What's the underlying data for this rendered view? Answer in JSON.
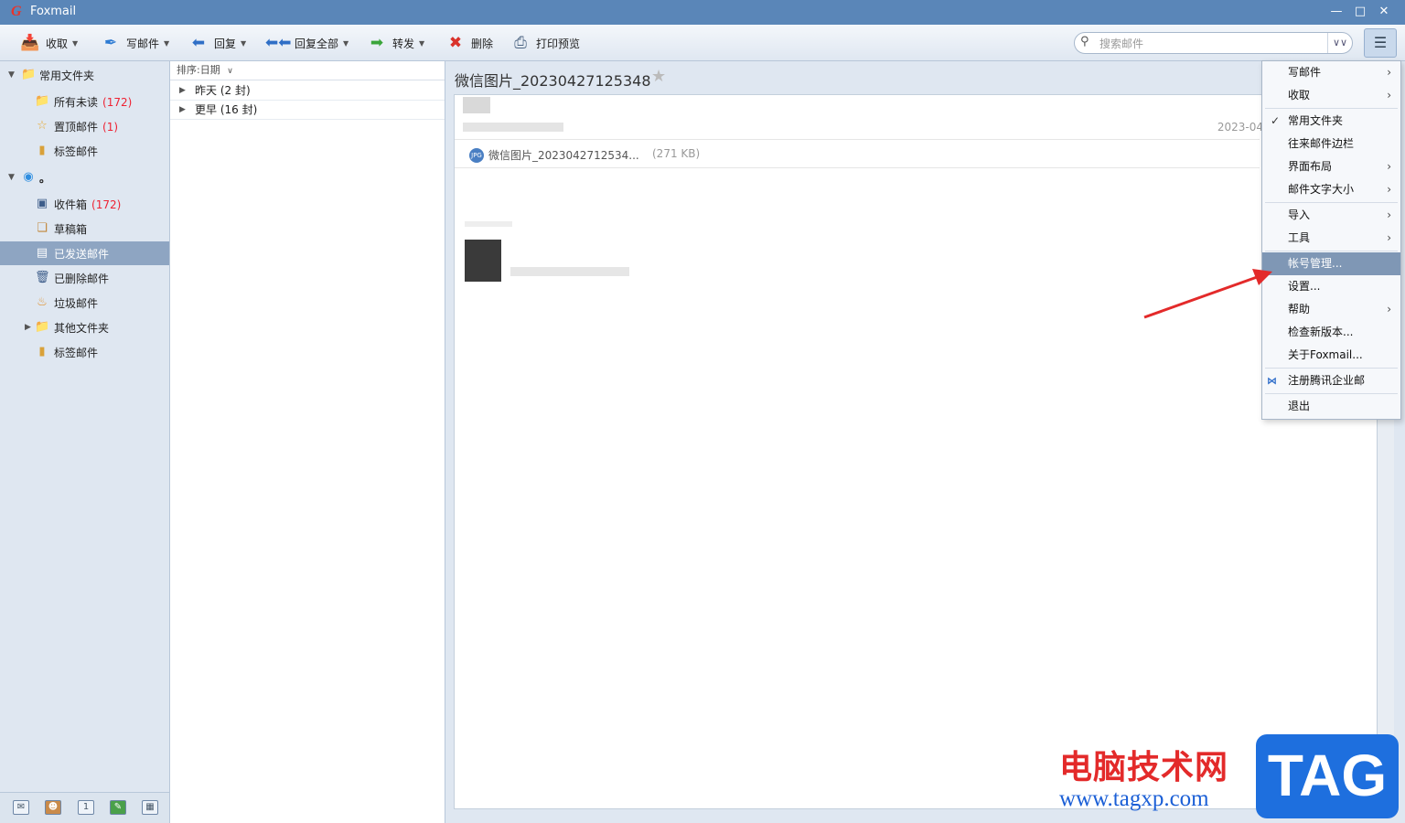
{
  "window": {
    "logo": "G",
    "title": "Foxmail"
  },
  "toolbar": {
    "receive": "收取",
    "compose": "写邮件",
    "reply": "回复",
    "reply_all": "回复全部",
    "forward": "转发",
    "delete": "删除",
    "print_preview": "打印预览",
    "search_placeholder": "搜索邮件"
  },
  "folders": {
    "common_group": "常用文件夹",
    "all_unread": "所有未读",
    "all_unread_count": "(172)",
    "pinned": "置顶邮件",
    "pinned_count": "(1)",
    "tagged_1": "标签邮件",
    "account": "。",
    "inbox": "收件箱",
    "inbox_count": "(172)",
    "drafts": "草稿箱",
    "sent": "已发送邮件",
    "deleted": "已删除邮件",
    "junk": "垃圾邮件",
    "other": "其他文件夹",
    "tagged_2": "标签邮件"
  },
  "bottom_icons": [
    "mail-icon",
    "contacts-icon",
    "calendar-icon",
    "notes-icon",
    "feed-icon"
  ],
  "list": {
    "sort_label": "排序:日期",
    "groups": [
      "昨天 (2 封)",
      "更早 (16 封)"
    ]
  },
  "message": {
    "subject": "微信图片_20230427125348",
    "date": "2023-04",
    "attachment_name": "微信图片_2023042712534...",
    "attachment_size": "(271 KB)",
    "attachment_badge": "JPG"
  },
  "menu": {
    "items": [
      "写邮件",
      "收取",
      "常用文件夹",
      "往来邮件边栏",
      "界面布局",
      "邮件文字大小",
      "导入",
      "工具",
      "帐号管理...",
      "设置...",
      "帮助",
      "检查新版本...",
      "关于Foxmail...",
      "注册腾讯企业邮",
      "退出"
    ]
  },
  "watermark": {
    "text": "电脑技术网",
    "url": "www.tagxp.com",
    "tag": "TAG"
  },
  "colors": {
    "titlebar": "#5a86b8",
    "selected": "#8ea5c2",
    "menu_highlight": "#7f97b5",
    "count": "#e22233",
    "arrow": "#e32a2a"
  }
}
